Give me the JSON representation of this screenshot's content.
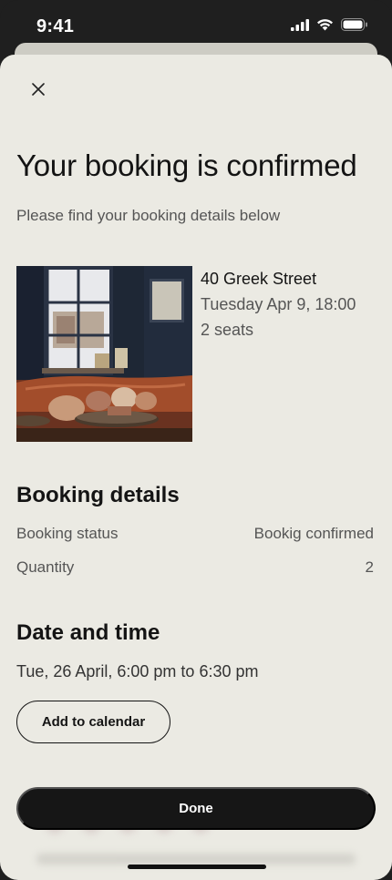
{
  "status_bar": {
    "time": "9:41"
  },
  "header": {
    "title": "Your booking is confirmed",
    "subtitle": "Please find your booking details below"
  },
  "venue": {
    "name": "40 Greek Street",
    "date": "Tuesday Apr 9, 18:00",
    "seats": "2 seats"
  },
  "booking_details": {
    "title": "Booking details",
    "rows": [
      {
        "label": "Booking status",
        "value": "Bookig confirmed"
      },
      {
        "label": "Quantity",
        "value": "2"
      }
    ]
  },
  "date_time": {
    "title": "Date and time",
    "value": "Tue, 26 April, 6:00 pm to 6:30 pm",
    "calendar_button": "Add to calendar"
  },
  "footer": {
    "done_button": "Done"
  }
}
